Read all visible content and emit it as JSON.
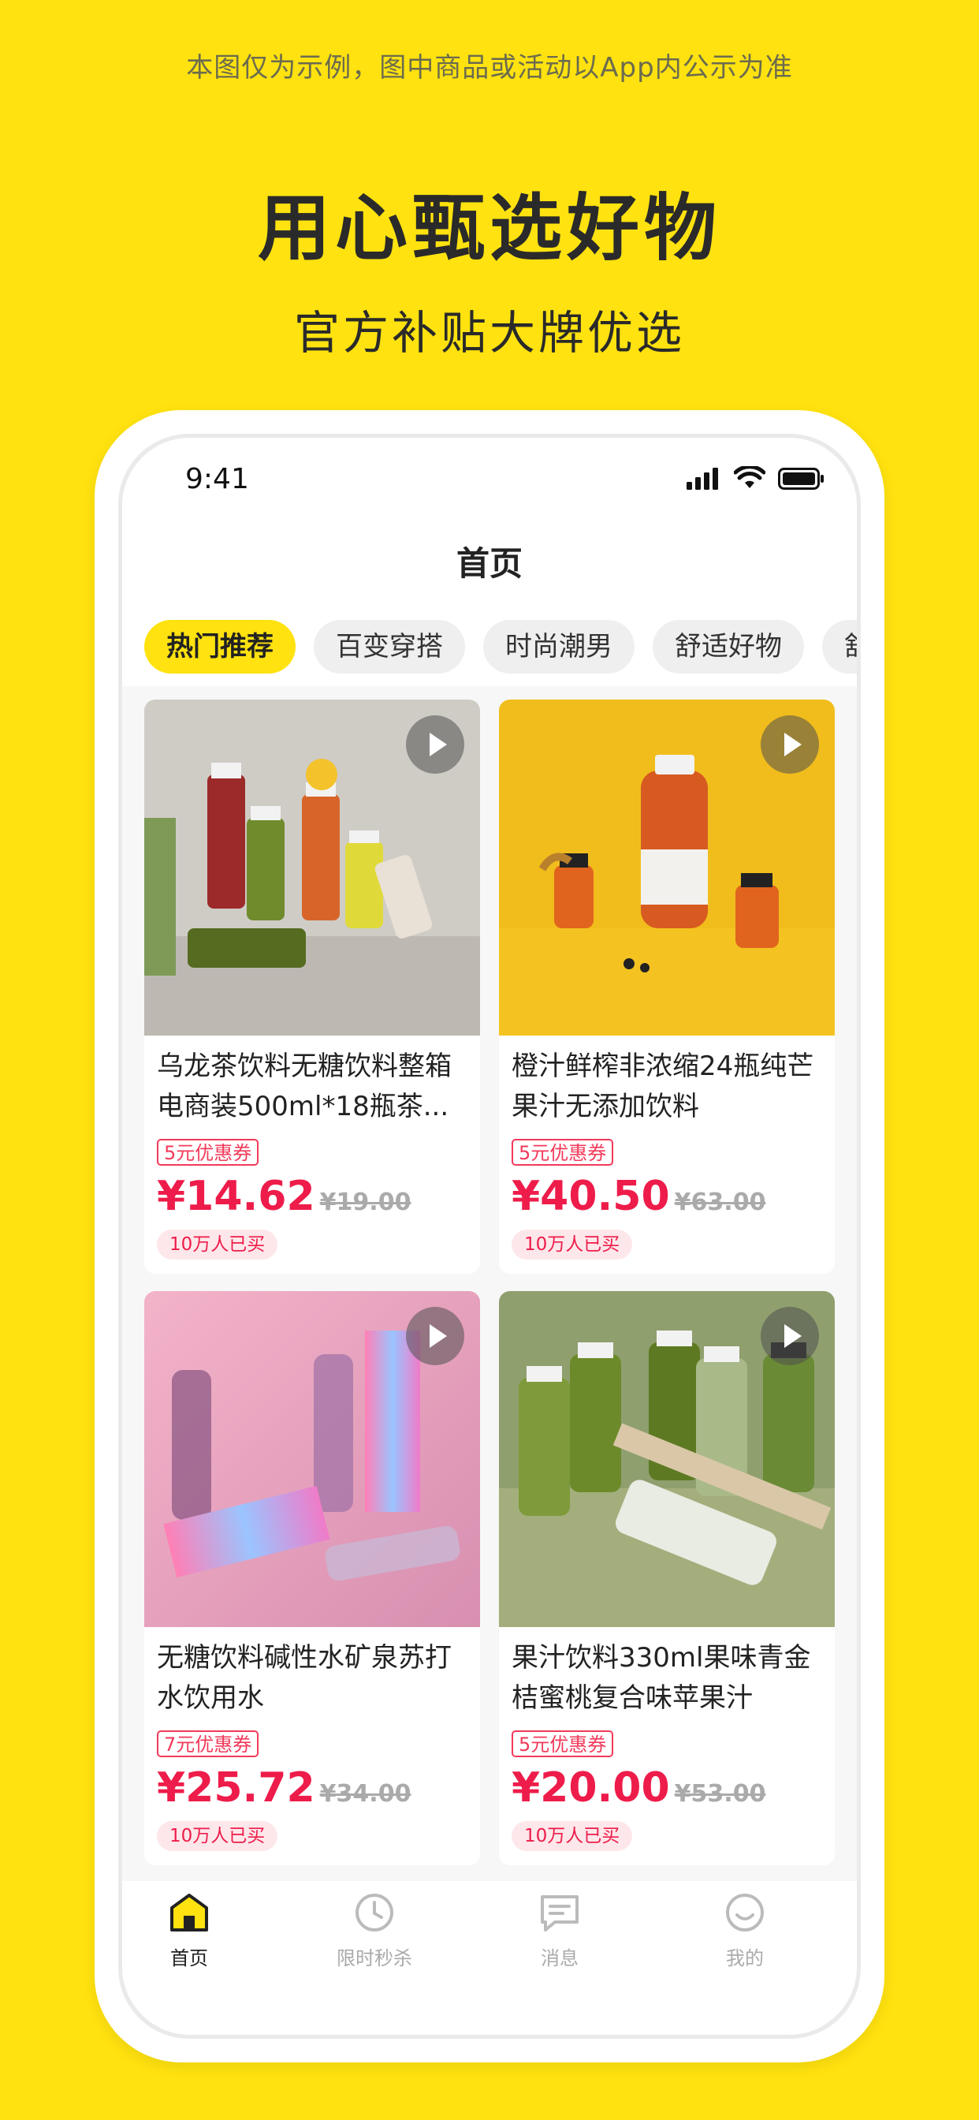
{
  "promo": {
    "disclaimer": "本图仅为示例，图中商品或活动以App内公示为准",
    "headline": "用心甄选好物",
    "subline": "官方补贴大牌优选"
  },
  "status": {
    "time": "9:41"
  },
  "header": {
    "title": "首页"
  },
  "tabs": [
    {
      "label": "热门推荐",
      "active": true
    },
    {
      "label": "百变穿搭"
    },
    {
      "label": "时尚潮男"
    },
    {
      "label": "舒适好物"
    },
    {
      "label": "舒"
    }
  ],
  "products": [
    {
      "title": "乌龙茶饮料无糖饮料整箱电商装500ml*18瓶茶...",
      "coupon": "5元优惠券",
      "price": "¥14.62",
      "original_price": "¥19.00",
      "sold": "10万人已买"
    },
    {
      "title": "橙汁鲜榨非浓缩24瓶纯芒果汁无添加饮料",
      "coupon": "5元优惠券",
      "price": "¥40.50",
      "original_price": "¥63.00",
      "sold": "10万人已买"
    },
    {
      "title": "无糖饮料碱性水矿泉苏打水饮用水",
      "coupon": "7元优惠券",
      "price": "¥25.72",
      "original_price": "¥34.00",
      "sold": "10万人已买"
    },
    {
      "title": "果汁饮料330ml果味青金桔蜜桃复合味苹果汁",
      "coupon": "5元优惠券",
      "price": "¥20.00",
      "original_price": "¥53.00",
      "sold": "10万人已买"
    }
  ],
  "bottom_nav": [
    {
      "label": "首页",
      "icon": "home-icon",
      "active": true
    },
    {
      "label": "限时秒杀",
      "icon": "clock-icon"
    },
    {
      "label": "消息",
      "icon": "message-icon"
    },
    {
      "label": "我的",
      "icon": "smile-icon"
    }
  ],
  "colors": {
    "brand_yellow": "#FFE20F",
    "price_red": "#EE1C4A",
    "coupon_red": "#F23A5A"
  }
}
